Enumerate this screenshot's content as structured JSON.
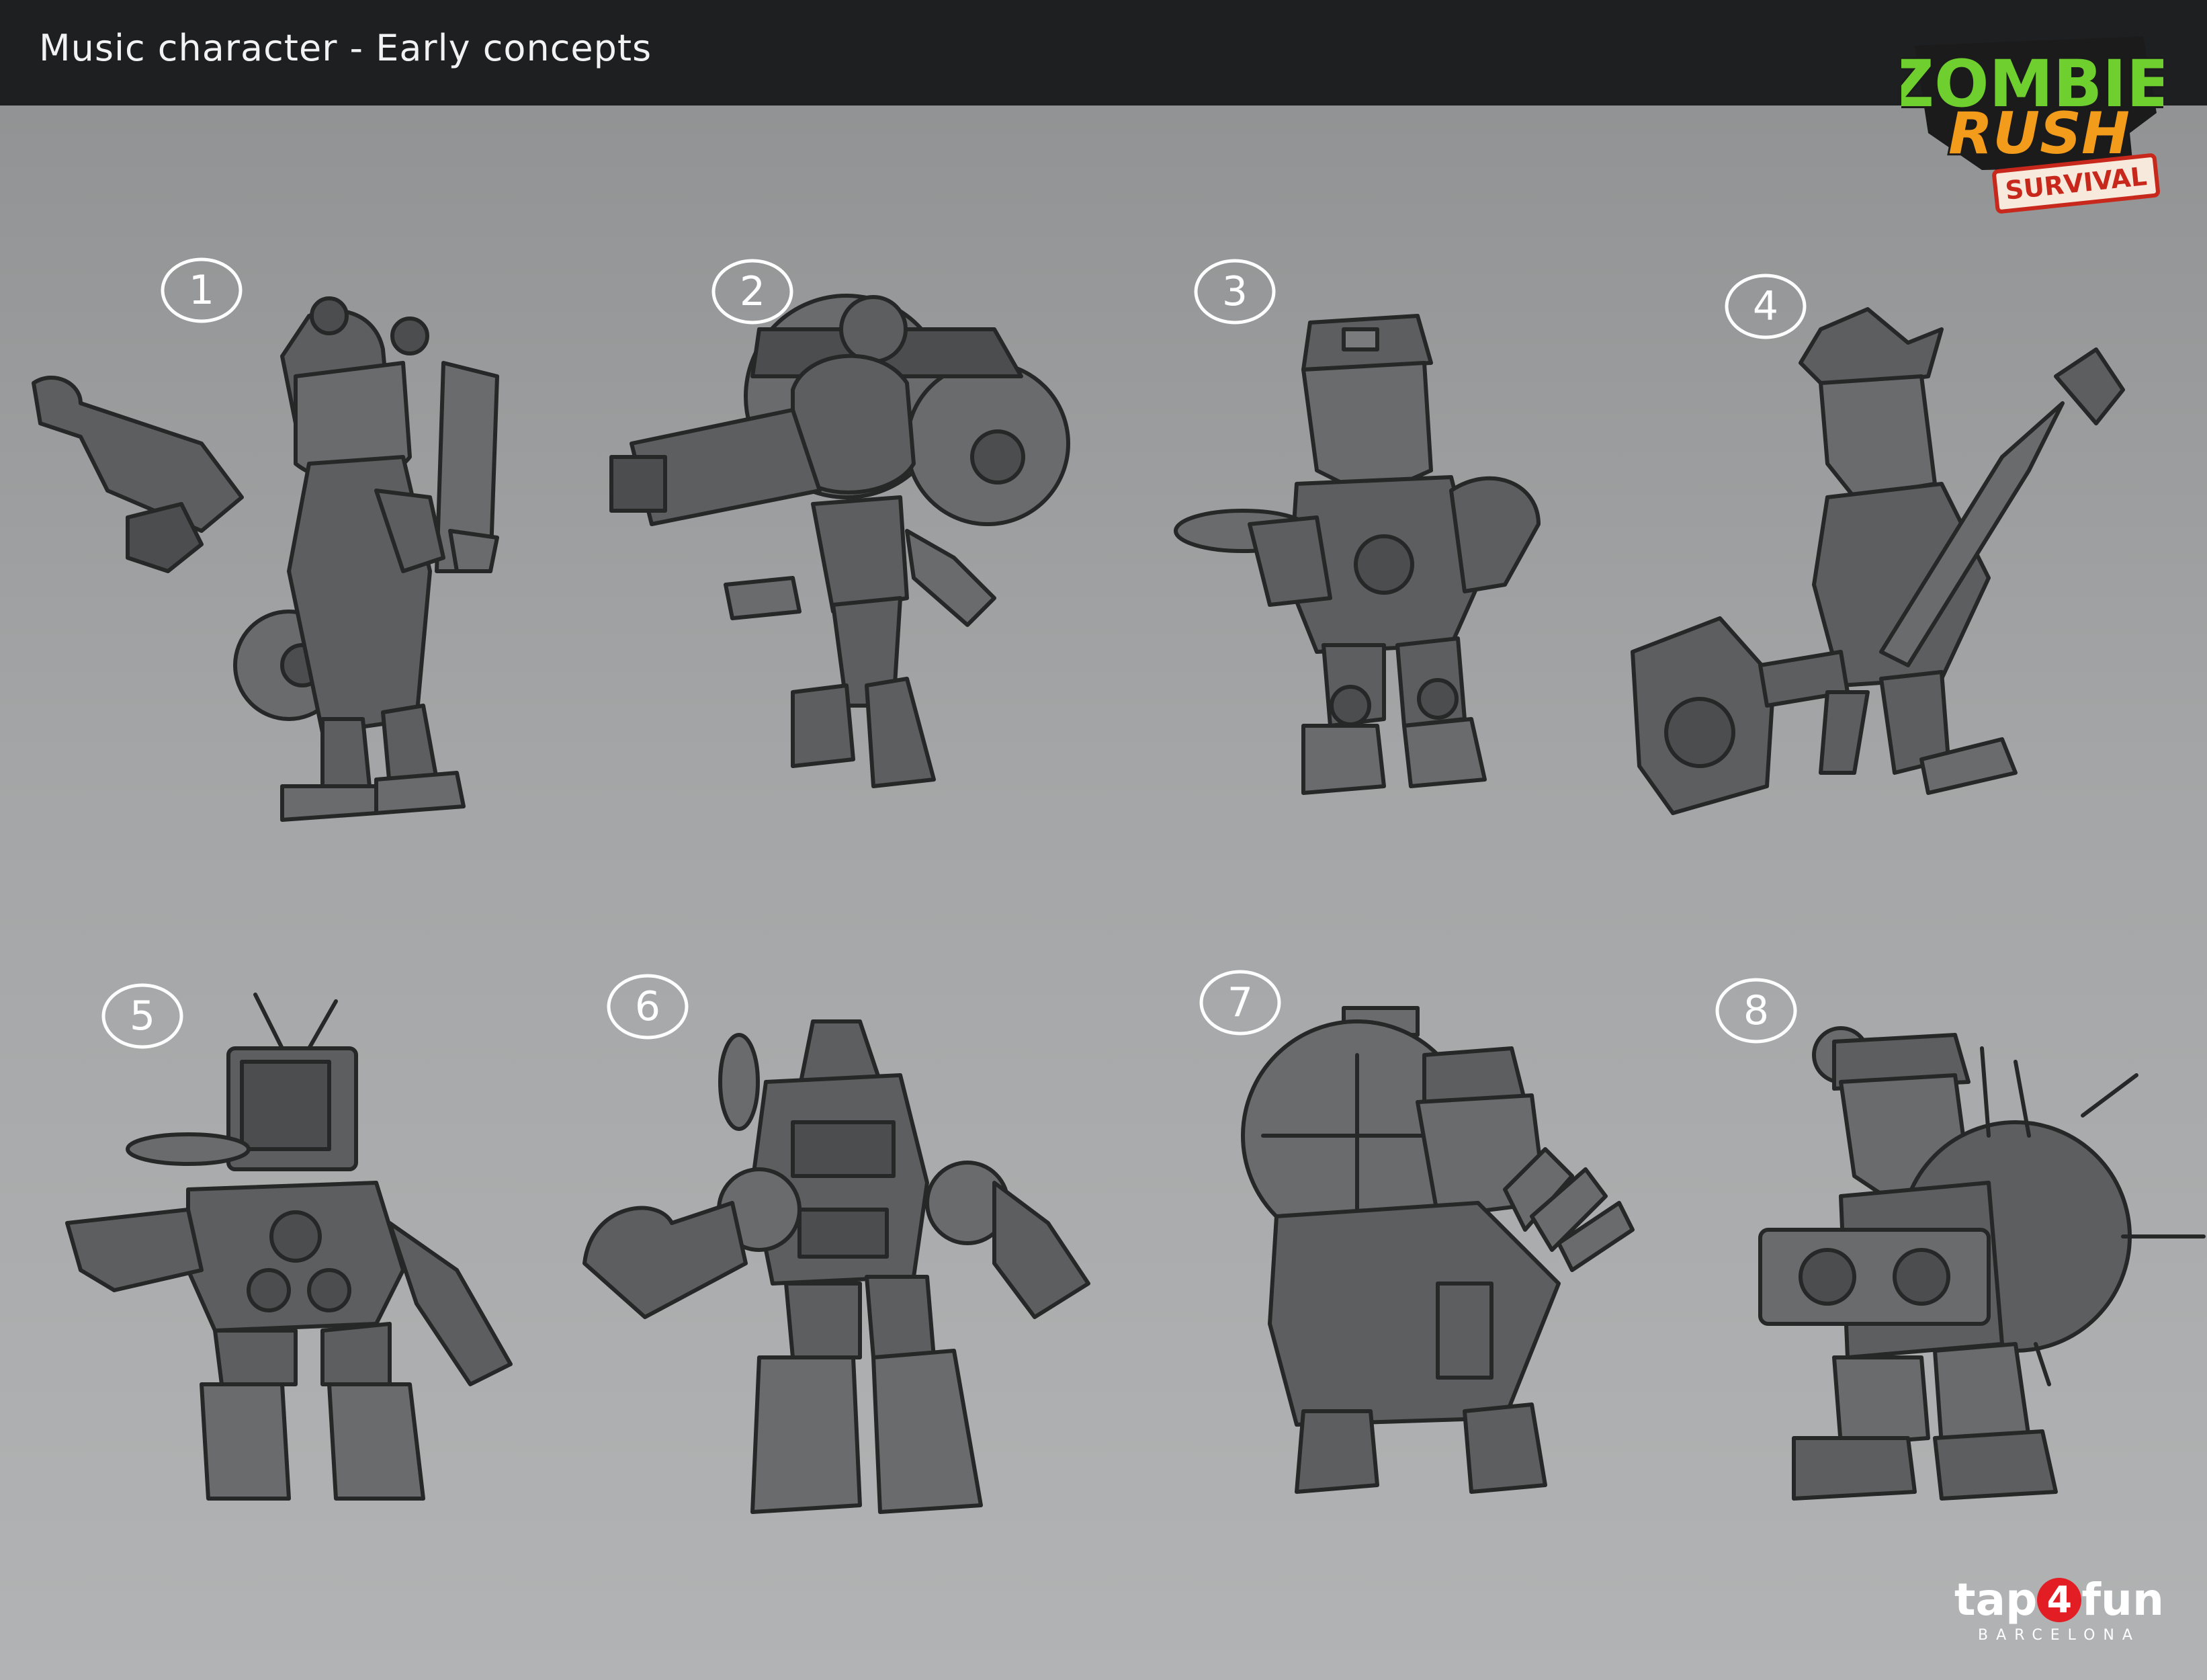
{
  "header": {
    "title": "Music character - Early concepts"
  },
  "logo": {
    "line1": "ZOMBIE",
    "line2": "RUSH",
    "line3": "SURVIVAL",
    "colors": {
      "green": "#6fcf2e",
      "orange": "#f39b1b",
      "red": "#c8281c",
      "outline": "#1b1b1b"
    }
  },
  "concepts": [
    {
      "number": "1"
    },
    {
      "number": "2"
    },
    {
      "number": "3"
    },
    {
      "number": "4"
    },
    {
      "number": "5"
    },
    {
      "number": "6"
    },
    {
      "number": "7"
    },
    {
      "number": "8"
    }
  ],
  "studio": {
    "name_left": "tap",
    "name_mid": "4",
    "name_right": "fun",
    "city": "BARCELONA",
    "accent": "#e31d24"
  }
}
